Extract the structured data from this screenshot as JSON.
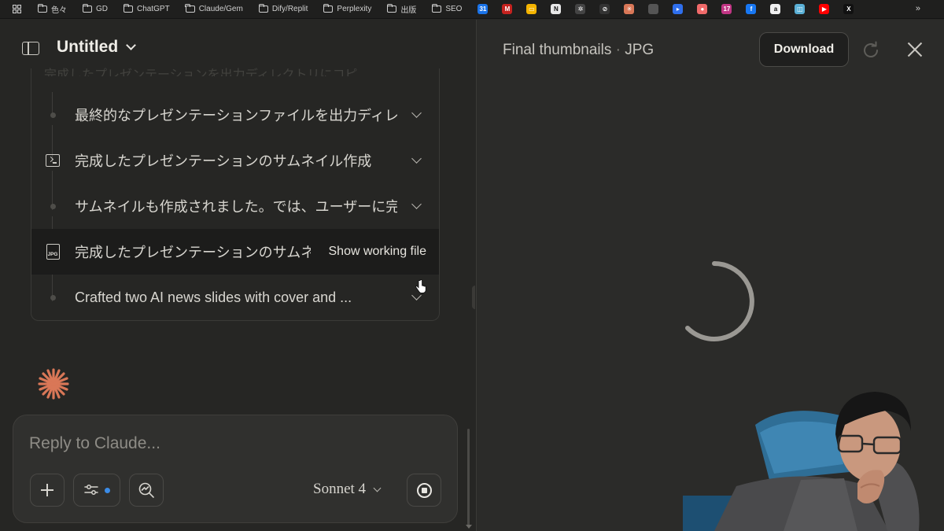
{
  "bookmarks": {
    "folders": [
      "色々",
      "GD",
      "ChatGPT",
      "Claude/Gem",
      "Dify/Replit",
      "Perplexity",
      "出版",
      "SEO"
    ],
    "sites": [
      {
        "name": "calendar-icon",
        "color": "#1a73e8",
        "glyph": "31"
      },
      {
        "name": "gmail-icon",
        "color": "#c5221f",
        "glyph": "M"
      },
      {
        "name": "slides-icon",
        "color": "#f4b400",
        "glyph": "▭"
      },
      {
        "name": "notion-icon",
        "color": "#e8e8e8",
        "glyph": "N"
      },
      {
        "name": "openai-icon",
        "color": "#444444",
        "glyph": "✲"
      },
      {
        "name": "grok-icon",
        "color": "#333333",
        "glyph": "⊘"
      },
      {
        "name": "claude-icon",
        "color": "#d97757",
        "glyph": "✳"
      },
      {
        "name": "apple-icon",
        "color": "#555555",
        "glyph": ""
      },
      {
        "name": "play-icon",
        "color": "#2f6fed",
        "glyph": "▸"
      },
      {
        "name": "asana-icon",
        "color": "#f06a6a",
        "glyph": "●"
      },
      {
        "name": "instagram-icon",
        "color": "#c13584",
        "glyph": "17"
      },
      {
        "name": "facebook-icon",
        "color": "#1877f2",
        "glyph": "f"
      },
      {
        "name": "amazon-icon",
        "color": "#f0f0f0",
        "glyph": "a"
      },
      {
        "name": "search-console-icon",
        "color": "#5ab0d6",
        "glyph": "◫"
      },
      {
        "name": "youtube-icon",
        "color": "#ff0000",
        "glyph": "▶"
      },
      {
        "name": "x-icon",
        "color": "#111111",
        "glyph": "X"
      }
    ],
    "more": "»"
  },
  "header": {
    "title": "Untitled"
  },
  "timeline": {
    "faded_text": "完成したプレゼンテーションを出力ディレクトリにコピ",
    "steps": [
      {
        "icon": "dot",
        "text": "最終的なプレゼンテーションファイルを出力ディレクトリ..."
      },
      {
        "icon": "terminal",
        "text": "完成したプレゼンテーションのサムネイル作成"
      },
      {
        "icon": "dot",
        "text": "サムネイルも作成されました。では、ユーザーに完成した..."
      },
      {
        "icon": "jpg",
        "text": "完成したプレゼンテーションのサムネイ...",
        "action": "Show working file"
      },
      {
        "icon": "dot",
        "text": "Crafted two AI news slides with cover and ..."
      }
    ],
    "jpg_label": "JPG"
  },
  "composer": {
    "placeholder": "Reply to Claude...",
    "model": "Sonnet 4"
  },
  "artifact": {
    "title": "Final thumbnails",
    "separator": "·",
    "type": "JPG",
    "download_label": "Download"
  },
  "colors": {
    "accent": "#d97757",
    "background": "#262624",
    "panel": "#2b2b29",
    "tools_dot": "#3b8ce8"
  }
}
